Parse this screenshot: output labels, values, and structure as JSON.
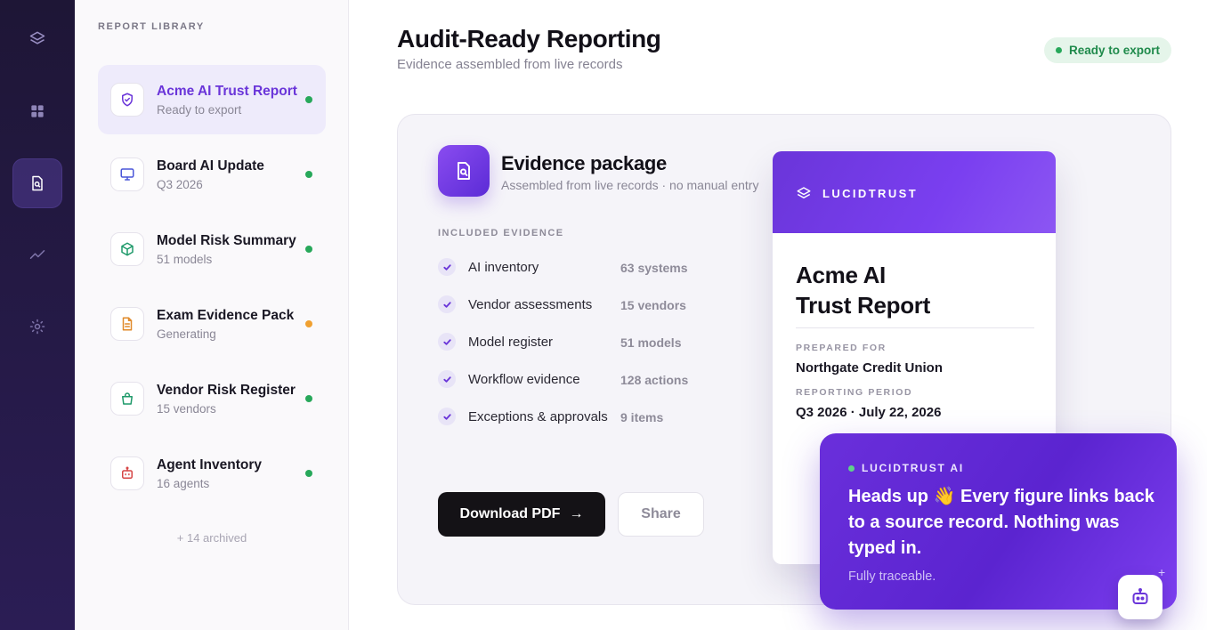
{
  "rail": {
    "items": [
      {
        "icon": "layers-icon"
      },
      {
        "icon": "grid-icon"
      },
      {
        "icon": "report-search-icon",
        "active": true
      },
      {
        "icon": "trend-line-icon"
      },
      {
        "icon": "gear-icon"
      }
    ]
  },
  "library": {
    "title": "REPORT LIBRARY",
    "items": [
      {
        "name": "Acme AI Trust Report",
        "sub": "Ready to export",
        "icon": "shield-check-icon",
        "status_color": "#27a85a",
        "active": true
      },
      {
        "name": "Board AI Update",
        "sub": "Q3 2026",
        "icon": "monitor-icon",
        "status_color": "#27a85a"
      },
      {
        "name": "Model Risk Summary",
        "sub": "51 models",
        "icon": "cube-icon",
        "status_color": "#27a85a"
      },
      {
        "name": "Exam Evidence Pack",
        "sub": "Generating",
        "icon": "document-icon",
        "status_color": "#f0a030"
      },
      {
        "name": "Vendor Risk Register",
        "sub": "15 vendors",
        "icon": "bag-icon",
        "status_color": "#27a85a"
      },
      {
        "name": "Agent Inventory",
        "sub": "16 agents",
        "icon": "robot-icon",
        "status_color": "#27a85a"
      }
    ],
    "archived": "+ 14 archived"
  },
  "header": {
    "title": "Audit-Ready Reporting",
    "subtitle": "Evidence assembled from live records",
    "status": "Ready to export"
  },
  "package": {
    "title": "Evidence package",
    "subtitle": "Assembled from live records · no manual entry",
    "included_label": "INCLUDED EVIDENCE",
    "evidence": [
      {
        "label": "AI inventory",
        "value": "63 systems"
      },
      {
        "label": "Vendor assessments",
        "value": "15 vendors"
      },
      {
        "label": "Model register",
        "value": "51 models"
      },
      {
        "label": "Workflow evidence",
        "value": "128 actions"
      },
      {
        "label": "Exceptions & approvals",
        "value": "9 items"
      }
    ],
    "download_label": "Download PDF",
    "download_arrow": "→",
    "share_label": "Share"
  },
  "preview": {
    "brand": "LUCIDTRUST",
    "title_line1": "Acme AI",
    "title_line2": "Trust Report",
    "prepared_for_label": "PREPARED FOR",
    "prepared_for": "Northgate Credit Union",
    "period_label": "REPORTING PERIOD",
    "period": "Q3 2026 · July 22, 2026"
  },
  "assistant": {
    "brand": "LUCIDTRUST AI",
    "message": "Heads up 👋 Every figure links back to a source record. Nothing was typed in.",
    "footnote": "Fully traceable.",
    "spark": "+"
  },
  "colors": {
    "accent": "#6a35d9",
    "success": "#27a85a",
    "warning": "#f0a030"
  }
}
